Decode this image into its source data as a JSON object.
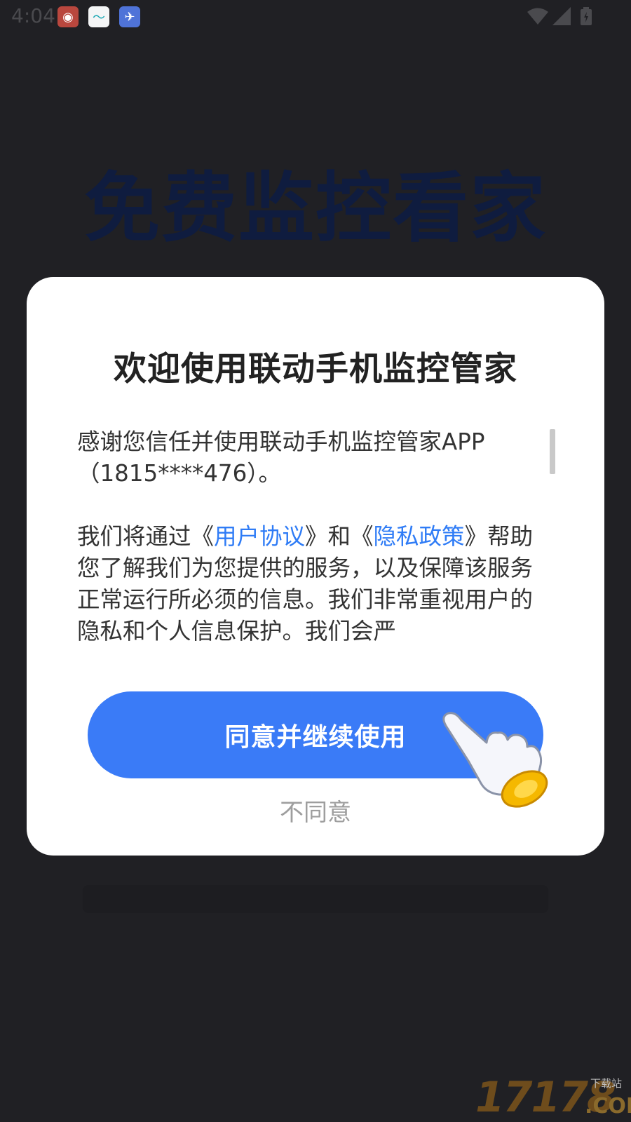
{
  "status_bar": {
    "time": "4:04",
    "notification_icons": [
      "weibo-icon",
      "app-wave-icon",
      "app-bird-icon"
    ],
    "wifi_icon": "wifi-icon",
    "signal_icon": "signal-icon",
    "battery_icon": "battery-charging-icon"
  },
  "background": {
    "title": "免费监控看家"
  },
  "dialog": {
    "title": "欢迎使用联动手机监控管家",
    "paragraph1": "感谢您信任并使用联动手机监控管家APP（1815****476）。",
    "paragraph2": {
      "prefix": "我们将通过《",
      "link_user_agreement": "用户协议",
      "middle": "》和《",
      "link_privacy_policy": "隐私政策",
      "suffix": "》帮助您了解我们为您提供的服务，以及保障该服务正常运行所必须的信息。我们非常重视用户的隐私和个人信息保护。我们会严"
    },
    "agree_button": "同意并继续使用",
    "disagree_button": "不同意"
  },
  "watermark": {
    "number": "17178",
    "small": "下载站",
    "domain": ".COM"
  },
  "colors": {
    "accent": "#3a7bf7",
    "link": "#2f7cf6",
    "overlay": "#202024"
  }
}
